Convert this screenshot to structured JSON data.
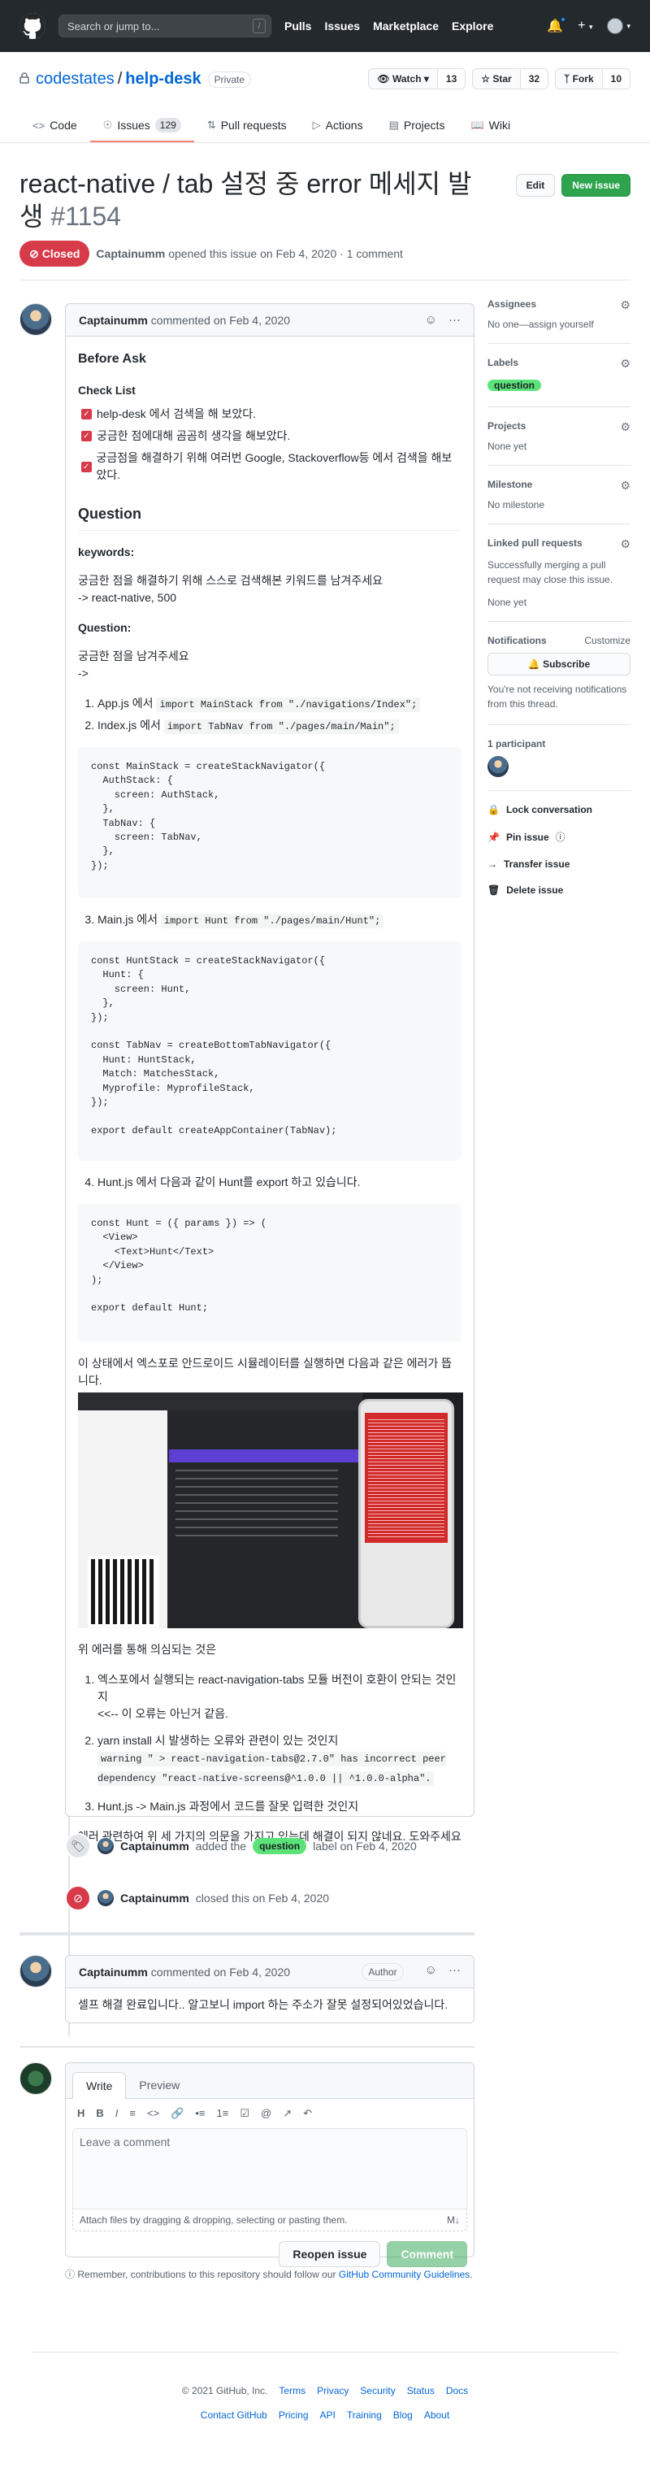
{
  "header": {
    "search_placeholder": "Search or jump to...",
    "search_key": "/",
    "nav": [
      "Pulls",
      "Issues",
      "Marketplace",
      "Explore"
    ]
  },
  "repo": {
    "owner": "codestates",
    "name": "help-desk",
    "visibility": "Private",
    "watch_label": "Watch",
    "watch_count": "13",
    "star_label": "Star",
    "star_count": "32",
    "fork_label": "Fork",
    "fork_count": "10",
    "tabs": [
      {
        "label": "Code",
        "icon": "code-icon"
      },
      {
        "label": "Issues",
        "icon": "issue-icon",
        "count": "129"
      },
      {
        "label": "Pull requests",
        "icon": "pull-request-icon"
      },
      {
        "label": "Actions",
        "icon": "play-icon"
      },
      {
        "label": "Projects",
        "icon": "project-icon"
      },
      {
        "label": "Wiki",
        "icon": "book-icon"
      }
    ]
  },
  "issue": {
    "title": "react-native / tab 설정 중 error 메세지 발생",
    "number": "#1154",
    "state": "Closed",
    "author": "Captainumm",
    "meta_text": "opened this issue on Feb 4, 2020 · 1 comment",
    "edit_label": "Edit",
    "new_issue_label": "New issue"
  },
  "first_comment": {
    "author": "Captainumm",
    "date_text": "commented on Feb 4, 2020",
    "h_before_ask": "Before Ask",
    "h_checklist": "Check List",
    "checklist": [
      "help-desk 에서 검색을 해 보았다.",
      "궁금한 점에대해 곰곰히 생각을 해보았다.",
      "궁금점을 해결하기 위해 여러번 Google, Stackoverflow등 에서 검색을 해보았다."
    ],
    "h_question": "Question",
    "keywords_h": "keywords:",
    "keywords_p1": "궁금한 점을 해결하기 위해 스스로 검색해본 키워드를 남겨주세요",
    "keywords_p2": "-> react-native, 500",
    "question_h": "Question:",
    "question_p1": "궁금한 점을 남겨주세요",
    "question_p2": "->",
    "step1_text": "App.js 에서 ",
    "step1_code": "import MainStack from \"./navigations/Index\";",
    "step2_text": "Index.js 에서 ",
    "step2_code": "import TabNav from \"./pages/main/Main\";",
    "code1": "const MainStack = createStackNavigator({\n  AuthStack: {\n    screen: AuthStack,\n  },\n  TabNav: {\n    screen: TabNav,\n  },\n});",
    "step3_text": "Main.js 에서 ",
    "step3_code": "import Hunt from \"./pages/main/Hunt\";",
    "code2": "const HuntStack = createStackNavigator({\n  Hunt: {\n    screen: Hunt,\n  },\n});\n\nconst TabNav = createBottomTabNavigator({\n  Hunt: HuntStack,\n  Match: MatchesStack,\n  Myprofile: MyprofileStack,\n});\n\nexport default createAppContainer(TabNav);",
    "step4_text": "Hunt.js 에서 다음과 같이 Hunt를 export 하고 있습니다.",
    "code3": "const Hunt = ({ params }) => (\n  <View>\n    <Text>Hunt</Text>\n  </View>\n);\n\nexport default Hunt;",
    "screenshot_caption": "이 상태에서 엑스포로 안드로이드 시뮬레이터를 실행하면 다음과 같은 에러가 뜹니다.",
    "suspect_intro": "위 에러를 통해 의심되는 것은",
    "suspect1_a": "엑스포에서 실행되는 react-navigation-tabs 모듈 버전이 호환이 안되는 것인지",
    "suspect1_b": "<<-- 이 오류는 아닌거 같음.",
    "suspect2_a": "yarn install 시 발생하는 오류와 관련이 있는 것인지",
    "suspect2_code": "warning \" > react-navigation-tabs@2.7.0\" has incorrect peer dependency \"react-native-screens@^1.0.0 || ^1.0.0-alpha\".",
    "suspect3": "Hunt.js -> Main.js 과정에서 코드를 잘못 입력한 것인지",
    "closing": "에러 관련하여 위 세 가지의 의문을 가지고 있는데 해결이 되지 않네요. 도와주세요ㅠ"
  },
  "events": {
    "labeled_user": "Captainumm",
    "labeled_pre": "added the",
    "labeled_label": "question",
    "labeled_post": "label on Feb 4, 2020",
    "closed_user": "Captainumm",
    "closed_text": "closed this on Feb 4, 2020"
  },
  "second_comment": {
    "author": "Captainumm",
    "date_text": "commented on Feb 4, 2020",
    "badge": "Author",
    "body": "셀프 해결 완료입니다.. 알고보니 import 하는 주소가 잘못 설정되어있었습니다."
  },
  "composer": {
    "tab_write": "Write",
    "tab_preview": "Preview",
    "placeholder": "Leave a comment",
    "attach_text": "Attach files by dragging & dropping, selecting or pasting them.",
    "reopen_label": "Reopen issue",
    "comment_label": "Comment",
    "reminder_pre": "Remember, contributions to this repository should follow our",
    "reminder_link": "GitHub Community Guidelines",
    "reminder_post": "."
  },
  "sidebar": {
    "assignees_h": "Assignees",
    "assignees_val": "No one—assign yourself",
    "labels_h": "Labels",
    "labels_val": "question",
    "projects_h": "Projects",
    "projects_val": "None yet",
    "milestone_h": "Milestone",
    "milestone_val": "No milestone",
    "linked_h": "Linked pull requests",
    "linked_desc": "Successfully merging a pull request may close this issue.",
    "linked_val": "None yet",
    "notifications_h": "Notifications",
    "customize": "Customize",
    "subscribe_label": "Subscribe",
    "notif_desc": "You're not receiving notifications from this thread.",
    "participants_h": "1 participant",
    "lock": "Lock conversation",
    "pin": "Pin issue",
    "transfer": "Transfer issue",
    "delete": "Delete issue"
  },
  "footer": {
    "copyright": "© 2021 GitHub, Inc.",
    "row1": [
      "Terms",
      "Privacy",
      "Security",
      "Status",
      "Docs"
    ],
    "row2": [
      "Contact GitHub",
      "Pricing",
      "API",
      "Training",
      "Blog",
      "About"
    ]
  },
  "colors": {
    "closed": "#d73a49",
    "label_question": "#5be37a",
    "primary": "#2ea44f",
    "link": "#0366d6"
  }
}
